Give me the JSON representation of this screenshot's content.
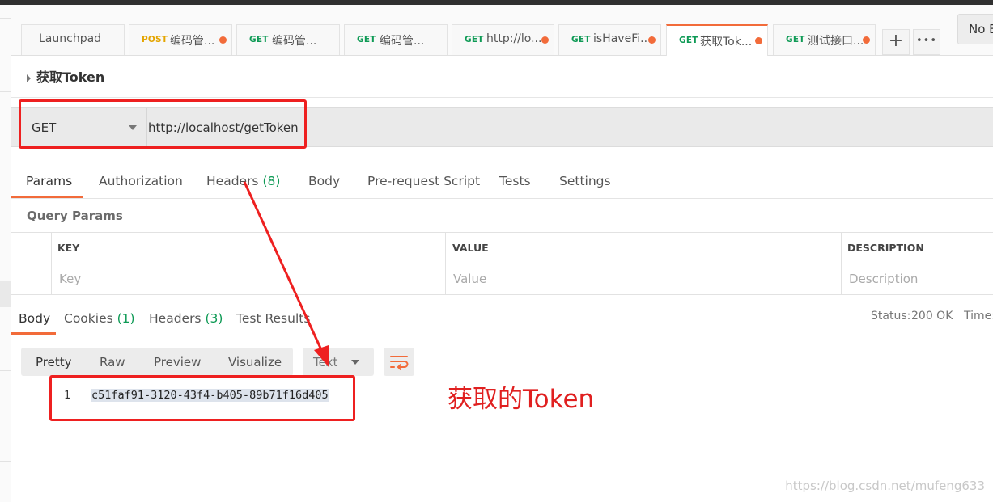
{
  "tabs": [
    {
      "method": "",
      "title": "Launchpad",
      "dot": false,
      "active": false
    },
    {
      "method": "POST",
      "title": "编码管...",
      "dot": true,
      "active": false
    },
    {
      "method": "GET",
      "title": "编码管...",
      "dot": false,
      "active": false
    },
    {
      "method": "GET",
      "title": "编码管...",
      "dot": false,
      "active": false
    },
    {
      "method": "GET",
      "title": "http://lo...",
      "dot": true,
      "active": false
    },
    {
      "method": "GET",
      "title": "isHaveFi...",
      "dot": true,
      "active": false
    },
    {
      "method": "GET",
      "title": "获取Tok...",
      "dot": true,
      "active": true
    },
    {
      "method": "GET",
      "title": "测试接口...",
      "dot": true,
      "active": false
    }
  ],
  "tab_actions": {
    "add": "+",
    "more": "•••"
  },
  "environment": "No E",
  "request": {
    "name": "获取Token",
    "method": "GET",
    "url": "http://localhost/getToken"
  },
  "request_tabs": {
    "params": "Params",
    "authorization": "Authorization",
    "headers": "Headers",
    "headers_count": "(8)",
    "body": "Body",
    "prerequest": "Pre-request Script",
    "tests": "Tests",
    "settings": "Settings"
  },
  "query_params": {
    "title": "Query Params",
    "columns": [
      "KEY",
      "VALUE",
      "DESCRIPTION"
    ],
    "placeholders": [
      "Key",
      "Value",
      "Description"
    ]
  },
  "response": {
    "tabs": {
      "body": "Body",
      "cookies": "Cookies",
      "cookies_count": "(1)",
      "headers": "Headers",
      "headers_count": "(3)",
      "test_results": "Test Results"
    },
    "status_label": "Status:",
    "status_value": "200 OK",
    "time_label": "Time:",
    "views": [
      "Pretty",
      "Raw",
      "Preview",
      "Visualize"
    ],
    "format": "Text",
    "line_number": "1",
    "body_text": "c51faf91-3120-43f4-b405-89b71f16d405"
  },
  "annotation": "获取的Token",
  "watermark": "https://blog.csdn.net/mufeng633",
  "colors": {
    "accent": "#f26b3a",
    "get": "#0e9a55",
    "post": "#e4a500",
    "highlight": "#ee2020"
  }
}
